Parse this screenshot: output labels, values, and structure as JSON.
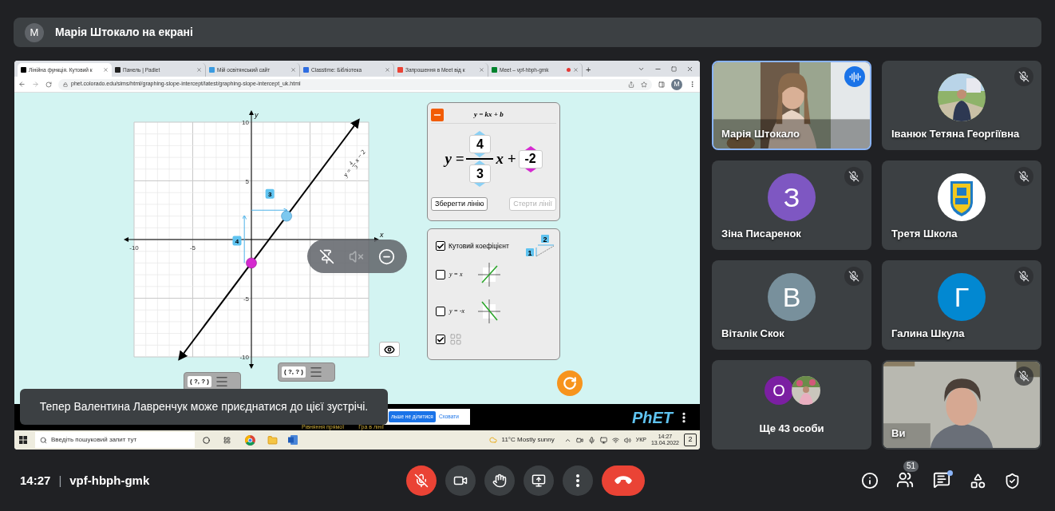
{
  "presenter_bar": {
    "initial": "M",
    "text": "Марія Штокало на екрані"
  },
  "browser": {
    "tabs": [
      {
        "title": "Лінійна функція. Кутовий к",
        "selected": true,
        "recording": false,
        "color": "#000000"
      },
      {
        "title": "Панель | Padlet",
        "selected": false,
        "recording": false,
        "color": "#222222"
      },
      {
        "title": "Мій освітянський сайт",
        "selected": false,
        "recording": false,
        "color": "#3b9be0"
      },
      {
        "title": "Classtime: Бібліотека",
        "selected": false,
        "recording": false,
        "color": "#2f6de1"
      },
      {
        "title": "Запрошення в Meet від к",
        "selected": false,
        "recording": false,
        "color": "#ea4335"
      },
      {
        "title": "Meet – vpf-hbph-gmk",
        "selected": false,
        "recording": true,
        "color": "#00832d"
      }
    ],
    "new_tab": "+",
    "url": "phet.colorado.edu/sims/html/graphing-slope-intercept/latest/graphing-slope-intercept_uk.html",
    "profile_initial": "M"
  },
  "simulation": {
    "graph": {
      "chart_data": {
        "type": "line",
        "xlabel": "x",
        "ylabel": "y",
        "xlim": [
          -10,
          10
        ],
        "ylim": [
          -10,
          10
        ],
        "xticks": [
          -10,
          -5
        ],
        "yticks": [
          -10,
          -5,
          5,
          10
        ],
        "grid": true,
        "x": [
          -6,
          9
        ],
        "series": [
          {
            "color": "#000000",
            "values": [
              -10,
              10
            ]
          }
        ]
      },
      "line_label": {
        "left": "y =",
        "numerator": "4",
        "denominator": "3",
        "right": "x − 2"
      },
      "slope": {
        "rise": "4",
        "run": "3"
      },
      "coordinate_readouts": [
        "( ?, ? )",
        "( ?, ? )"
      ]
    },
    "equation_panel": {
      "title": "y = kx + b",
      "lhs": "y =",
      "numerator": "4",
      "denominator": "3",
      "x_term": "x +",
      "intercept": "-2",
      "buttons": [
        {
          "label": "Зберегти лінію",
          "disabled": false
        },
        {
          "label": "Стерти лінії",
          "disabled": true
        }
      ]
    },
    "options_panel": {
      "items": [
        {
          "kind": "slope",
          "label": "Кутовий коефіцієнт",
          "checked": true,
          "rise": "1",
          "run": "2"
        },
        {
          "kind": "identity",
          "label": "y = x",
          "checked": false
        },
        {
          "kind": "negative_identity",
          "label": "y = -x",
          "checked": false
        },
        {
          "kind": "grid",
          "checked": true
        }
      ]
    },
    "footer": {
      "logo": "PhET",
      "screens": [
        "Рівняння прямої",
        "Гра в лінії"
      ]
    }
  },
  "share_bar": {
    "stop": "льше не ділитися",
    "hide": "Сховати"
  },
  "taskbar": {
    "search_placeholder": "Введіть пошуковий запит тут",
    "weather": "11°C Mostly sunny",
    "language": "УКР",
    "time": "14:27",
    "date": "13.04.2022",
    "notifications": "2"
  },
  "toast": "Тепер Валентина Лавренчук може приєднатися до цієї зустрічі.",
  "participants": [
    {
      "kind": "video",
      "name": "Марія Штокало",
      "muted": false,
      "speaking": true
    },
    {
      "name": "Іванюк Тетяна Георгіївна",
      "muted": true,
      "speaking": false
    },
    {
      "kind": "initial",
      "initial": "З",
      "color": "#7e57c2",
      "name": "Зіна Писаренок",
      "muted": true,
      "speaking": false
    },
    {
      "kind": "logo",
      "name": "Третя Школа",
      "muted": true,
      "speaking": false
    },
    {
      "kind": "initial",
      "initial": "В",
      "color": "#78909c",
      "name": "Віталік Скок",
      "muted": true,
      "speaking": false
    },
    {
      "kind": "initial",
      "initial": "Г",
      "color": "#0288d1",
      "name": "Галина Шкула",
      "muted": true,
      "speaking": false
    },
    {
      "kind": "others",
      "initial": "О",
      "color": "#7b1fa2",
      "name": "Ще 43 особи",
      "muted": false,
      "speaking": false
    },
    {
      "kind": "self",
      "name": "Ви",
      "muted": true,
      "speaking": false
    }
  ],
  "meeting": {
    "time": "14:27",
    "separator": "|",
    "code": "vpf-hbph-gmk"
  },
  "controls": [
    {
      "kind": "mic",
      "off": true
    },
    {
      "kind": "camera",
      "off": false
    },
    {
      "kind": "hand"
    },
    {
      "kind": "present"
    },
    {
      "kind": "more"
    },
    {
      "kind": "end"
    }
  ],
  "side_controls": {
    "people_count": "51",
    "chat_unread": true
  }
}
